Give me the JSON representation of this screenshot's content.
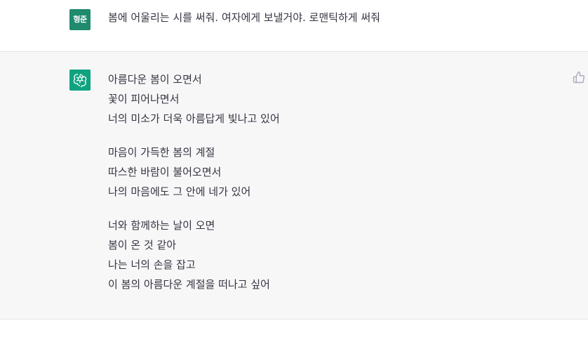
{
  "user_message": {
    "avatar_text": "형준",
    "text": "봄에 어울리는 시를 써줘. 여자에게 보낼거야. 로맨틱하게 써줘"
  },
  "assistant_message": {
    "avatar_icon": "openai-logo-icon",
    "stanzas": [
      {
        "lines": [
          "아름다운 봄이 오면서",
          "꽃이 피어나면서",
          "너의 미소가 더욱 아름답게 빛나고 있어"
        ]
      },
      {
        "lines": [
          "마음이 가득한 봄의 계절",
          "따스한 바람이 불어오면서",
          "나의 마음에도 그 안에 네가 있어"
        ]
      },
      {
        "lines": [
          "너와 함께하는 날이 오면",
          "봄이 온 것 같아",
          "나는 너의 손을 잡고",
          "이 봄의 아름다운 계절을 떠나고 싶어"
        ]
      }
    ],
    "feedback_icon": "thumbs-up-icon"
  },
  "colors": {
    "user_avatar_bg": "#1f8a6e",
    "assistant_avatar_bg": "#10a37f",
    "assistant_row_bg": "#f7f7f8",
    "text": "#343541"
  }
}
